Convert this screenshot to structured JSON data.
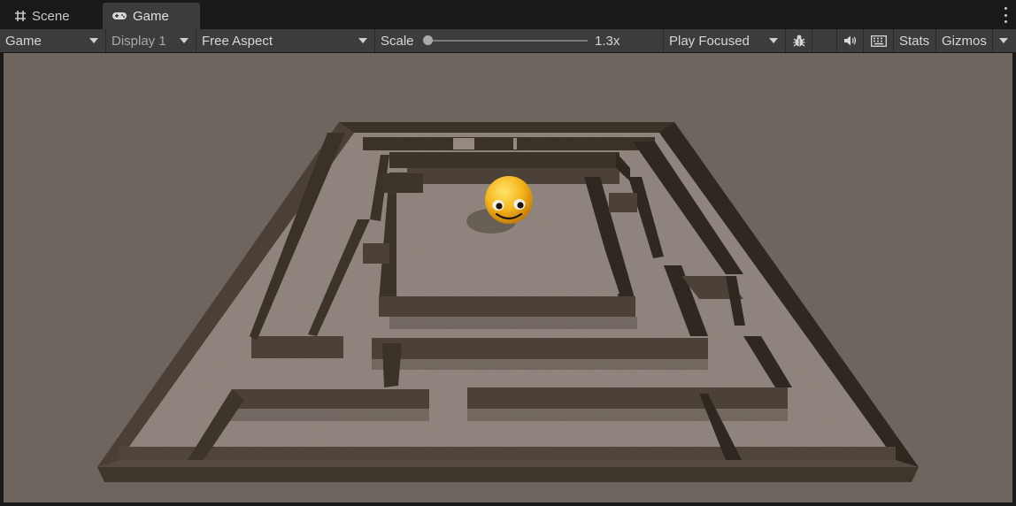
{
  "tabs": [
    {
      "label": "Scene",
      "icon": "grid-icon"
    },
    {
      "label": "Game",
      "icon": "gamepad-icon"
    }
  ],
  "toolbar": {
    "view_mode": "Game",
    "display": "Display 1",
    "aspect": "Free Aspect",
    "scale_label": "Scale",
    "scale_value": "1.3x",
    "scale_fraction": 0.02,
    "play_mode": "Play Focused",
    "stats_label": "Stats",
    "gizmos_label": "Gizmos"
  },
  "colors": {
    "viewport_bg": "#6e655f",
    "floor": "#948a82",
    "wall_top": "#4a4037",
    "wall_side": "#2d2722",
    "ball": "#f3b31b"
  }
}
